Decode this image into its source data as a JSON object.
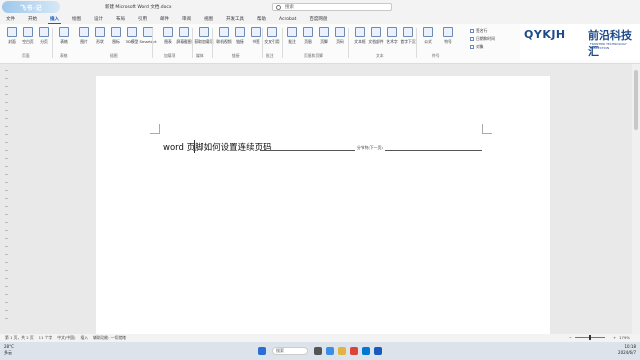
{
  "app": {
    "badge": "飞书·记",
    "doc_title": "新建 Microsoft Word 文档.docx",
    "search_placeholder": "搜索"
  },
  "tabs": [
    "文件",
    "开始",
    "插入",
    "绘图",
    "设计",
    "布局",
    "引用",
    "邮件",
    "审阅",
    "视图",
    "开发工具",
    "帮助",
    "Acrobat",
    "百度网盘"
  ],
  "active_tab": "插入",
  "ribbon": {
    "buttons": [
      {
        "label": "封面",
        "icon": "cover-icon"
      },
      {
        "label": "空白页",
        "icon": "blank-page-icon"
      },
      {
        "label": "分页",
        "icon": "page-break-icon"
      },
      {
        "label": "表格",
        "icon": "table-icon"
      },
      {
        "label": "图片",
        "icon": "picture-icon"
      },
      {
        "label": "形状",
        "icon": "shapes-icon"
      },
      {
        "label": "图标",
        "icon": "icons-icon"
      },
      {
        "label": "3D模型",
        "icon": "3d-model-icon"
      },
      {
        "label": "SmartArt",
        "icon": "smartart-icon"
      },
      {
        "label": "图表",
        "icon": "chart-icon"
      },
      {
        "label": "屏幕截图",
        "icon": "screenshot-icon"
      },
      {
        "label": "获取加载项",
        "icon": "addins-icon"
      },
      {
        "label": "联机视频",
        "icon": "video-icon"
      },
      {
        "label": "链接",
        "icon": "link-icon"
      },
      {
        "label": "书签",
        "icon": "bookmark-icon"
      },
      {
        "label": "交叉引用",
        "icon": "cross-ref-icon"
      },
      {
        "label": "批注",
        "icon": "comment-icon"
      },
      {
        "label": "页眉",
        "icon": "header-icon"
      },
      {
        "label": "页脚",
        "icon": "footer-icon"
      },
      {
        "label": "页码",
        "icon": "page-number-icon"
      },
      {
        "label": "文本框",
        "icon": "textbox-icon"
      },
      {
        "label": "文档部件",
        "icon": "quick-parts-icon"
      },
      {
        "label": "艺术字",
        "icon": "wordart-icon"
      },
      {
        "label": "首字下沉",
        "icon": "dropcap-icon"
      },
      {
        "label": "公式",
        "icon": "equation-icon"
      },
      {
        "label": "符号",
        "icon": "symbol-icon"
      }
    ],
    "mini_items": [
      "签名行",
      "日期和时间",
      "对象"
    ],
    "groups": [
      "页面",
      "表格",
      "插图",
      "加载项",
      "媒体",
      "链接",
      "批注",
      "页眉和页脚",
      "文本",
      "符号"
    ]
  },
  "brand": {
    "latin": "QYKJH",
    "chinese": "前沿科技汇",
    "subtitle": "FRONTIER TECHNOLOGY COLLECTION"
  },
  "document": {
    "heading": "word 页脚如何设置连续页码",
    "section_break": "分节符(下一页)"
  },
  "status": {
    "page": "第 1 页，共 2 页",
    "words": "11 个字",
    "language": "中文(中国)",
    "insert_mode": "插入",
    "accessibility": "辅助功能: 一切就绪",
    "zoom": "179%"
  },
  "taskbar": {
    "weather_temp": "28°C",
    "weather_text": "多云",
    "search_label": "搜索",
    "time": "10:18",
    "date": "2024/6/7"
  },
  "colors": {
    "accent": "#185abd",
    "brand": "#1e4a8a"
  }
}
